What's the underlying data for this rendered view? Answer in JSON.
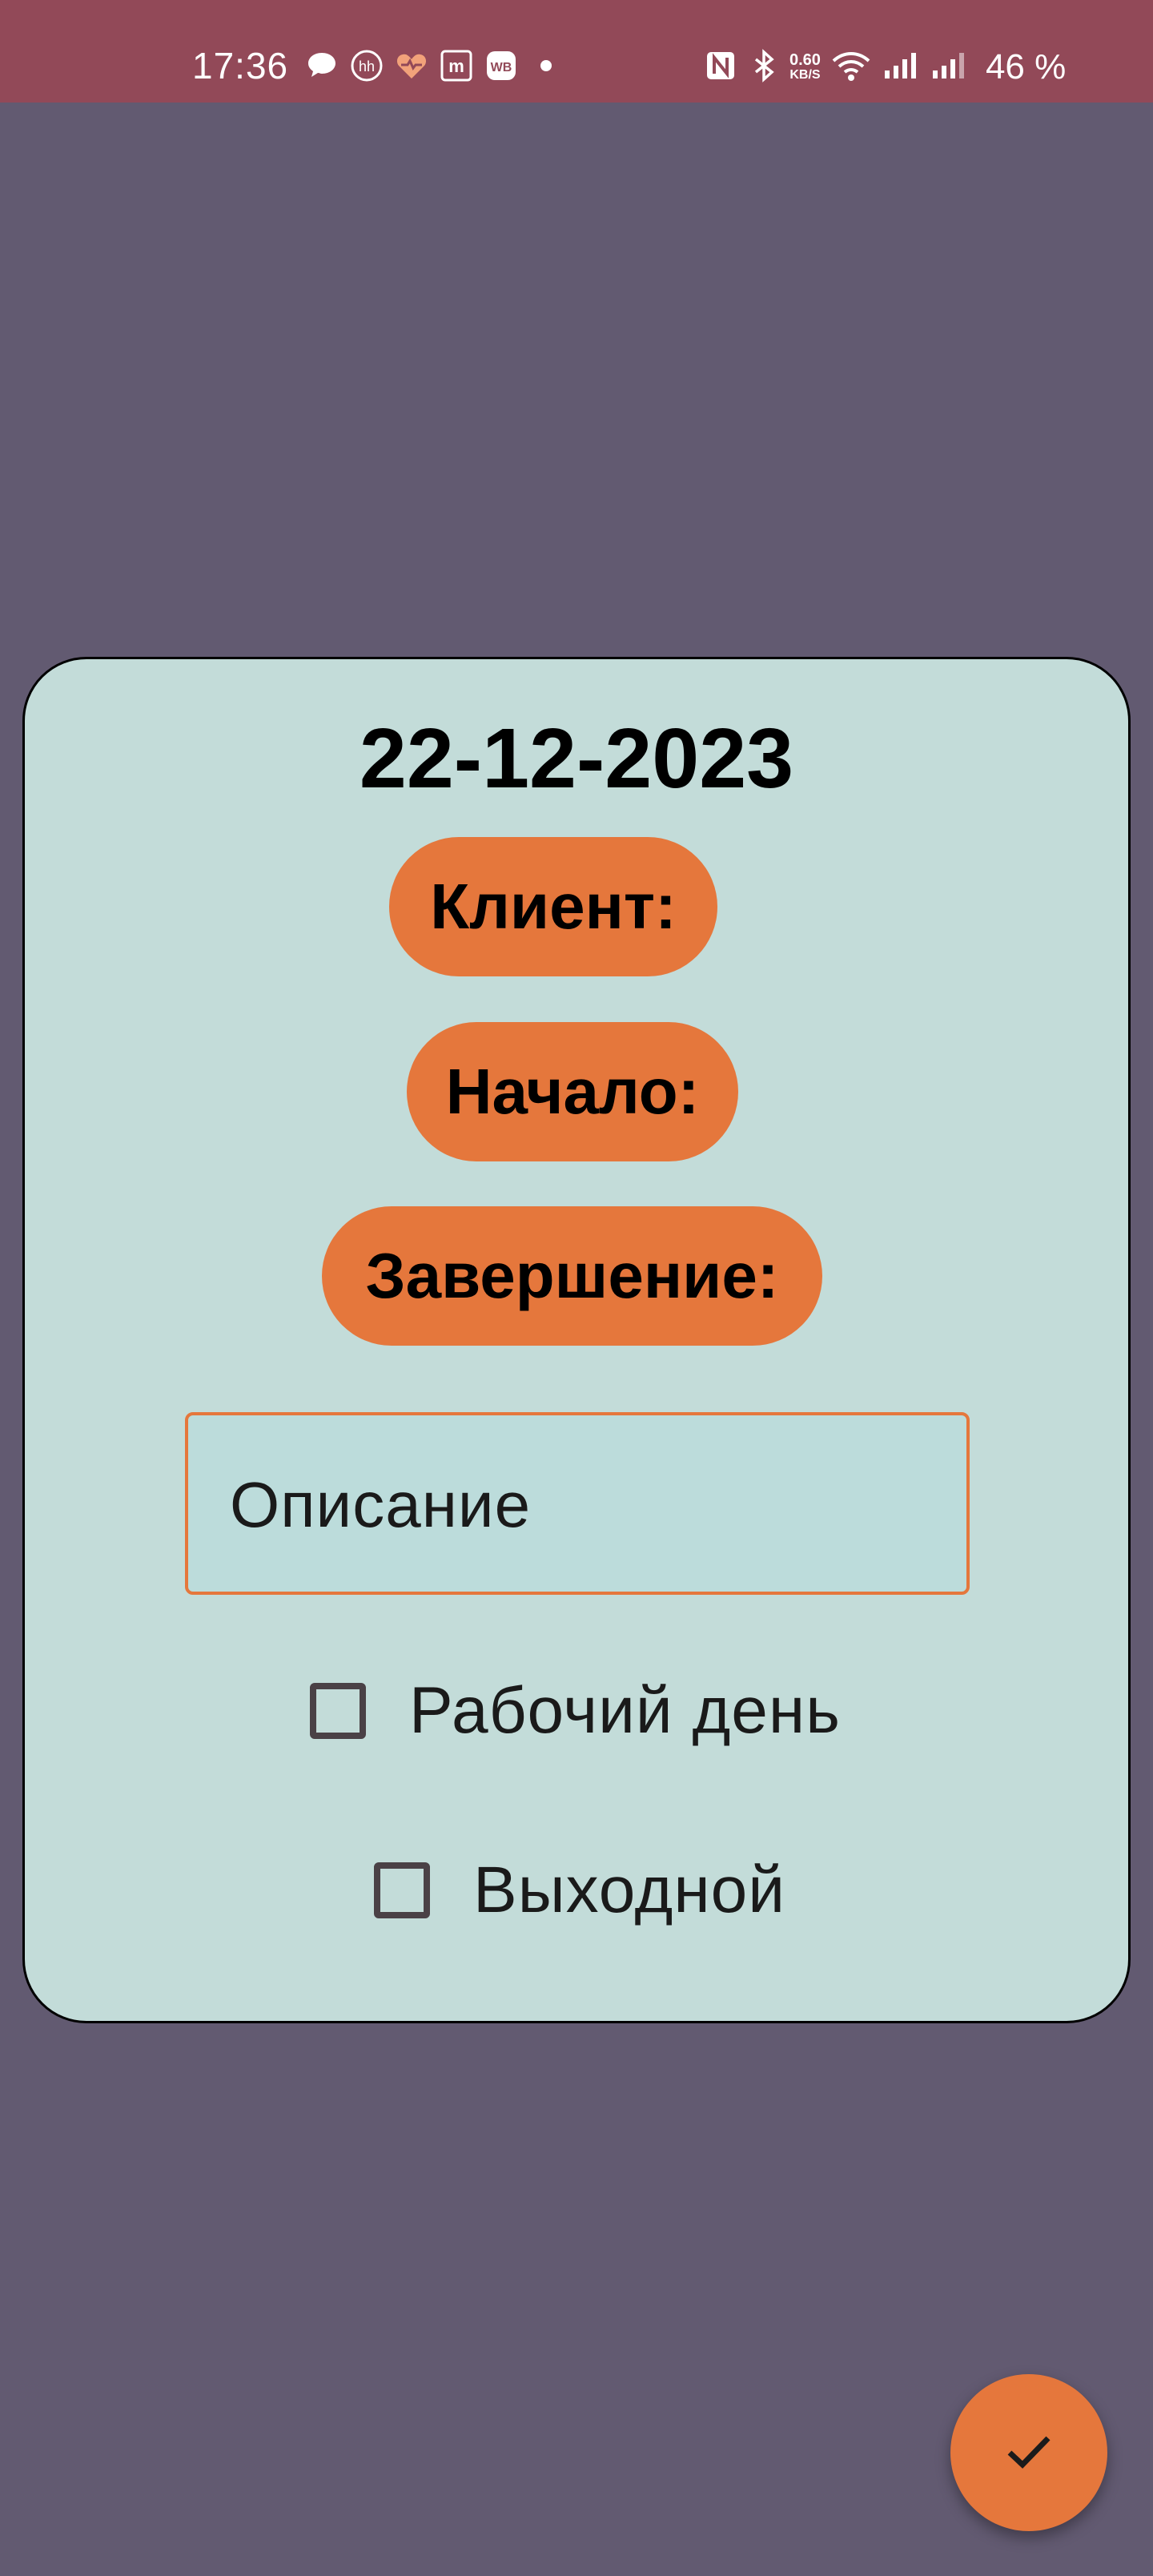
{
  "status_bar": {
    "time": "17:36",
    "network_speed_value": "0.60",
    "network_speed_unit": "KB/S",
    "battery": "46 %",
    "notification_icons": [
      "chat-bubble-icon",
      "hh-icon",
      "heart-rate-icon",
      "m-icon",
      "wb-icon",
      "dot-icon"
    ],
    "system_icons": [
      "nfc-icon",
      "bluetooth-icon",
      "wifi-icon",
      "signal-icon",
      "signal-icon"
    ]
  },
  "card": {
    "date": "22-12-2023",
    "client_label": "Клиент:",
    "start_label": "Начало:",
    "end_label": "Завершение:",
    "description_placeholder": "Описание",
    "checkboxes": [
      {
        "label": "Рабочий день",
        "checked": false
      },
      {
        "label": "Выходной",
        "checked": false
      }
    ]
  },
  "fab": {
    "icon": "check-icon"
  },
  "colors": {
    "background": "#625a71",
    "status_bar": "#924958",
    "card": "#c3dcd9",
    "accent": "#e5773c"
  }
}
